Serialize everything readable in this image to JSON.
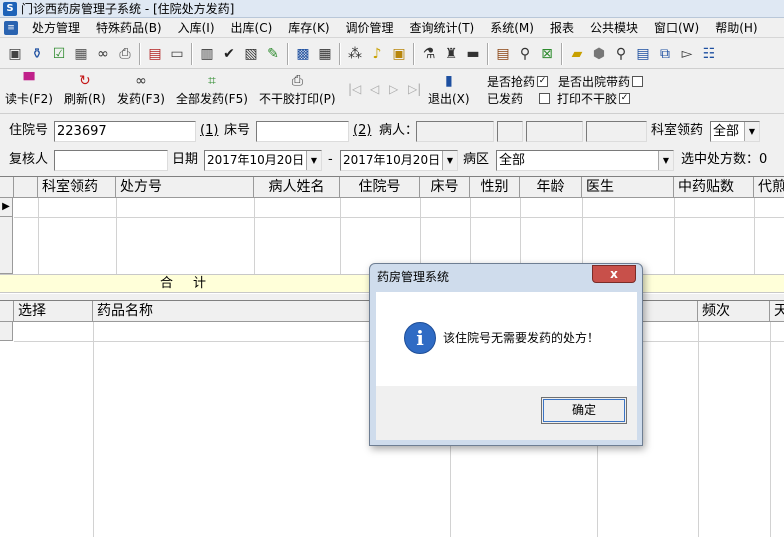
{
  "window": {
    "title": "门诊西药房管理子系统 - [住院处方发药]"
  },
  "menu": [
    "处方管理",
    "特殊药品(B)",
    "入库(I)",
    "出库(C)",
    "库存(K)",
    "调价管理",
    "查询统计(T)",
    "系统(M)",
    "报表",
    "公共模块",
    "窗口(W)",
    "帮助(H)"
  ],
  "toolbar_icons": [
    "clipboard-icon",
    "bottle-icon",
    "checklist-icon",
    "calculator-icon",
    "binoculars-icon",
    "scan-icon",
    "page-icon",
    "card-icon",
    "document-icon",
    "check-doc-icon",
    "export-icon",
    "edit-icon",
    "monitor-icon",
    "grid-icon",
    "bell-icon",
    "pm-icon",
    "pill-icon",
    "pill-search-icon",
    "ledger-icon",
    "drawer-icon",
    "thermometer-icon",
    "magnifier-icon",
    "excel-icon",
    "folder-icon",
    "stop-icon",
    "zoom-icon",
    "list-icon",
    "window-icon",
    "send-icon",
    "drug-icon"
  ],
  "actions": {
    "read_card": "读卡(F2)",
    "refresh": "刷新(R)",
    "dispense": "发药(F3)",
    "dispense_all": "全部发药(F5)",
    "print_no_dry": "不干胶打印(P)",
    "exit": "退出(X)"
  },
  "checks": {
    "robbed": {
      "label": "是否抢药",
      "checked": true
    },
    "discharge": {
      "label": "是否出院带药",
      "checked": false
    },
    "dispensed": {
      "label": "已发药",
      "checked": false
    },
    "no_print_dry": {
      "label": "打印不干胶",
      "checked": true
    }
  },
  "form": {
    "admission_no_label": "住院号",
    "admission_no": "223697",
    "step1": "(1)",
    "bed_label": "床号",
    "step2": "(2)",
    "patient_label": "病人：",
    "dept_label": "科室领药",
    "dept_value": "全部",
    "reviewer_label": "复核人",
    "date_label": "日期",
    "date_from": "2017年10月20日",
    "date_sep": "-",
    "date_to": "2017年10月20日",
    "ward_label": "病区",
    "ward_value": "全部",
    "selected_count_label": "选中处方数：0"
  },
  "grid1": {
    "headers": [
      "科室领药",
      "处方号",
      "病人姓名",
      "住院号",
      "床号",
      "性别",
      "年龄",
      "医生",
      "中药贴数",
      "代煎"
    ],
    "total_label": "合计"
  },
  "grid2": {
    "headers": [
      "选择",
      "药品名称",
      "频次",
      "天"
    ]
  },
  "dialog": {
    "title": "药房管理系统",
    "close": "x",
    "message": "该住院号无需要发药的处方！",
    "ok": "确定"
  }
}
